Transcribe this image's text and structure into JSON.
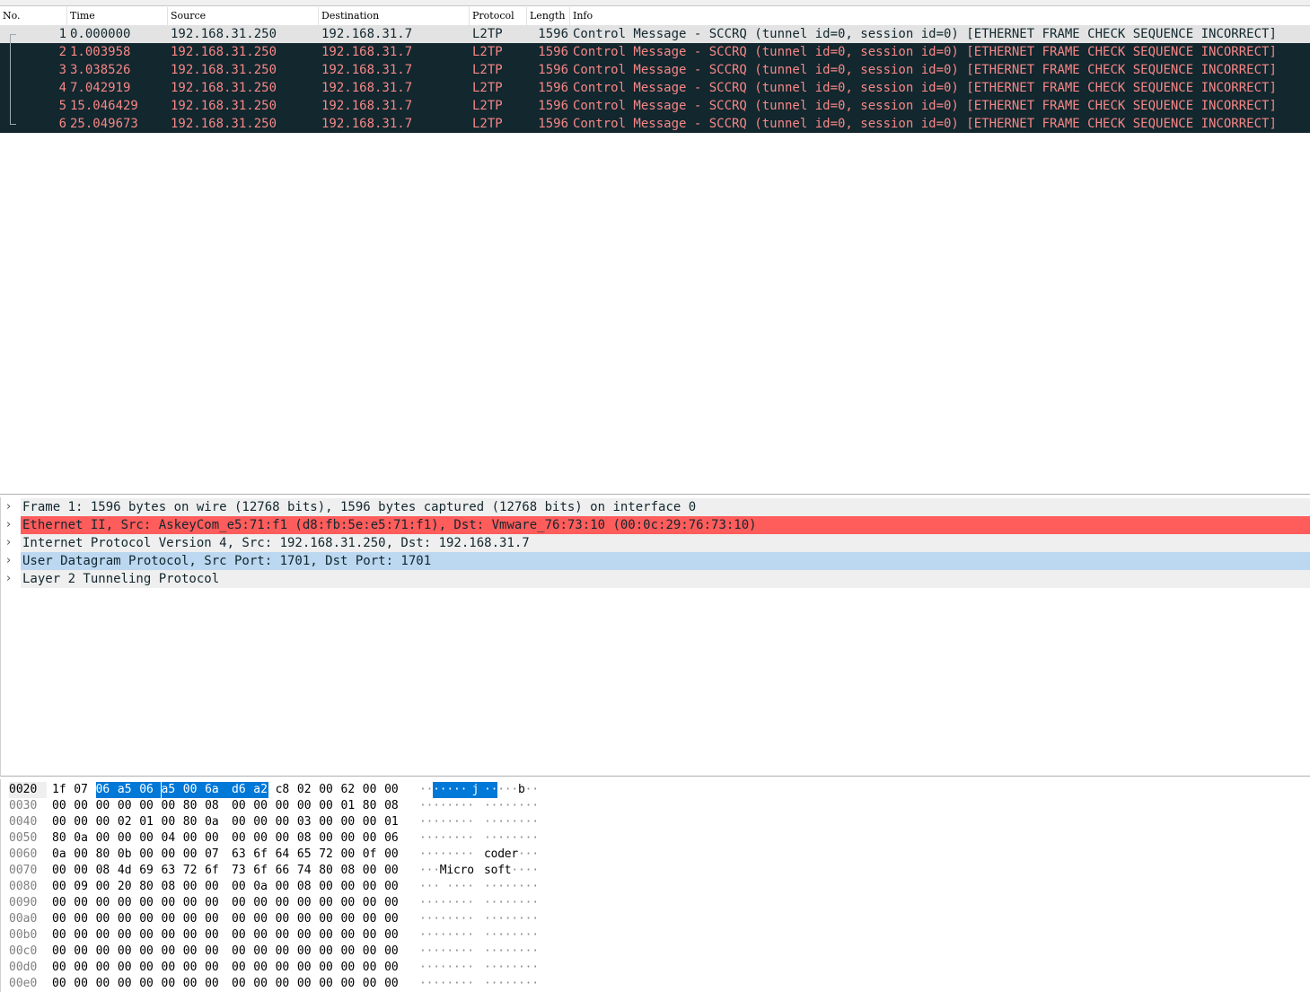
{
  "columns": [
    "No.",
    "Time",
    "Source",
    "Destination",
    "Protocol",
    "Length",
    "Info"
  ],
  "packets": [
    {
      "no": "1",
      "time": "0.000000",
      "source": "192.168.31.250",
      "destination": "192.168.31.7",
      "protocol": "L2TP",
      "length": "1596",
      "info": "Control Message - SCCRQ (tunnel id=0, session id=0) [ETHERNET FRAME CHECK SEQUENCE INCORRECT]"
    },
    {
      "no": "2",
      "time": "1.003958",
      "source": "192.168.31.250",
      "destination": "192.168.31.7",
      "protocol": "L2TP",
      "length": "1596",
      "info": "Control Message - SCCRQ (tunnel id=0, session id=0) [ETHERNET FRAME CHECK SEQUENCE INCORRECT]"
    },
    {
      "no": "3",
      "time": "3.038526",
      "source": "192.168.31.250",
      "destination": "192.168.31.7",
      "protocol": "L2TP",
      "length": "1596",
      "info": "Control Message - SCCRQ (tunnel id=0, session id=0) [ETHERNET FRAME CHECK SEQUENCE INCORRECT]"
    },
    {
      "no": "4",
      "time": "7.042919",
      "source": "192.168.31.250",
      "destination": "192.168.31.7",
      "protocol": "L2TP",
      "length": "1596",
      "info": "Control Message - SCCRQ (tunnel id=0, session id=0) [ETHERNET FRAME CHECK SEQUENCE INCORRECT]"
    },
    {
      "no": "5",
      "time": "15.046429",
      "source": "192.168.31.250",
      "destination": "192.168.31.7",
      "protocol": "L2TP",
      "length": "1596",
      "info": "Control Message - SCCRQ (tunnel id=0, session id=0) [ETHERNET FRAME CHECK SEQUENCE INCORRECT]"
    },
    {
      "no": "6",
      "time": "25.049673",
      "source": "192.168.31.250",
      "destination": "192.168.31.7",
      "protocol": "L2TP",
      "length": "1596",
      "info": "Control Message - SCCRQ (tunnel id=0, session id=0) [ETHERNET FRAME CHECK SEQUENCE INCORRECT]"
    }
  ],
  "details": [
    {
      "text": "Frame 1: 1596 bytes on wire (12768 bits), 1596 bytes captured (12768 bits) on interface 0",
      "style": "gray"
    },
    {
      "text": "Ethernet II, Src: AskeyCom_e5:71:f1 (d8:fb:5e:e5:71:f1), Dst: Vmware_76:73:10 (00:0c:29:76:73:10)",
      "style": "red"
    },
    {
      "text": "Internet Protocol Version 4, Src: 192.168.31.250, Dst: 192.168.31.7",
      "style": "gray"
    },
    {
      "text": "User Datagram Protocol, Src Port: 1701, Dst Port: 1701",
      "style": "blue"
    },
    {
      "text": "Layer 2 Tunneling Protocol",
      "style": "gray"
    }
  ],
  "bytes": [
    {
      "offset": "0020",
      "hex": [
        "1f",
        "07",
        "06",
        "a5",
        "06",
        "a5",
        "00",
        "6a",
        "d6",
        "a2",
        "c8",
        "02",
        "00",
        "62",
        "00",
        "00"
      ],
      "ascii": [
        "·",
        "·",
        "·",
        "·",
        "·",
        "·",
        "·",
        "j",
        "·",
        "·",
        "·",
        "·",
        "·",
        "b",
        "·",
        "·"
      ],
      "highlight": [
        2,
        3,
        4,
        5,
        6,
        7,
        8,
        9
      ]
    },
    {
      "offset": "0030",
      "hex": [
        "00",
        "00",
        "00",
        "00",
        "00",
        "00",
        "80",
        "08",
        "00",
        "00",
        "00",
        "00",
        "00",
        "01",
        "80",
        "08"
      ],
      "ascii": [
        "·",
        "·",
        "·",
        "·",
        "·",
        "·",
        "·",
        "·",
        "·",
        "·",
        "·",
        "·",
        "·",
        "·",
        "·",
        "·"
      ],
      "highlight": []
    },
    {
      "offset": "0040",
      "hex": [
        "00",
        "00",
        "00",
        "02",
        "01",
        "00",
        "80",
        "0a",
        "00",
        "00",
        "00",
        "03",
        "00",
        "00",
        "00",
        "01"
      ],
      "ascii": [
        "·",
        "·",
        "·",
        "·",
        "·",
        "·",
        "·",
        "·",
        "·",
        "·",
        "·",
        "·",
        "·",
        "·",
        "·",
        "·"
      ],
      "highlight": []
    },
    {
      "offset": "0050",
      "hex": [
        "80",
        "0a",
        "00",
        "00",
        "00",
        "04",
        "00",
        "00",
        "00",
        "00",
        "00",
        "08",
        "00",
        "00",
        "00",
        "06"
      ],
      "ascii": [
        "·",
        "·",
        "·",
        "·",
        "·",
        "·",
        "·",
        "·",
        "·",
        "·",
        "·",
        "·",
        "·",
        "·",
        "·",
        "·"
      ],
      "highlight": []
    },
    {
      "offset": "0060",
      "hex": [
        "0a",
        "00",
        "80",
        "0b",
        "00",
        "00",
        "00",
        "07",
        "63",
        "6f",
        "64",
        "65",
        "72",
        "00",
        "0f",
        "00"
      ],
      "ascii": [
        "·",
        "·",
        "·",
        "·",
        "·",
        "·",
        "·",
        "·",
        "c",
        "o",
        "d",
        "e",
        "r",
        "·",
        "·",
        "·"
      ],
      "highlight": []
    },
    {
      "offset": "0070",
      "hex": [
        "00",
        "00",
        "08",
        "4d",
        "69",
        "63",
        "72",
        "6f",
        "73",
        "6f",
        "66",
        "74",
        "80",
        "08",
        "00",
        "00"
      ],
      "ascii": [
        "·",
        "·",
        "·",
        "M",
        "i",
        "c",
        "r",
        "o",
        "s",
        "o",
        "f",
        "t",
        "·",
        "·",
        "·",
        "·"
      ],
      "highlight": []
    },
    {
      "offset": "0080",
      "hex": [
        "00",
        "09",
        "00",
        "20",
        "80",
        "08",
        "00",
        "00",
        "00",
        "0a",
        "00",
        "08",
        "00",
        "00",
        "00",
        "00"
      ],
      "ascii": [
        "·",
        "·",
        "·",
        " ",
        "·",
        "·",
        "·",
        "·",
        "·",
        "·",
        "·",
        "·",
        "·",
        "·",
        "·",
        "·"
      ],
      "highlight": []
    },
    {
      "offset": "0090",
      "hex": [
        "00",
        "00",
        "00",
        "00",
        "00",
        "00",
        "00",
        "00",
        "00",
        "00",
        "00",
        "00",
        "00",
        "00",
        "00",
        "00"
      ],
      "ascii": [
        "·",
        "·",
        "·",
        "·",
        "·",
        "·",
        "·",
        "·",
        "·",
        "·",
        "·",
        "·",
        "·",
        "·",
        "·",
        "·"
      ],
      "highlight": []
    },
    {
      "offset": "00a0",
      "hex": [
        "00",
        "00",
        "00",
        "00",
        "00",
        "00",
        "00",
        "00",
        "00",
        "00",
        "00",
        "00",
        "00",
        "00",
        "00",
        "00"
      ],
      "ascii": [
        "·",
        "·",
        "·",
        "·",
        "·",
        "·",
        "·",
        "·",
        "·",
        "·",
        "·",
        "·",
        "·",
        "·",
        "·",
        "·"
      ],
      "highlight": []
    },
    {
      "offset": "00b0",
      "hex": [
        "00",
        "00",
        "00",
        "00",
        "00",
        "00",
        "00",
        "00",
        "00",
        "00",
        "00",
        "00",
        "00",
        "00",
        "00",
        "00"
      ],
      "ascii": [
        "·",
        "·",
        "·",
        "·",
        "·",
        "·",
        "·",
        "·",
        "·",
        "·",
        "·",
        "·",
        "·",
        "·",
        "·",
        "·"
      ],
      "highlight": []
    },
    {
      "offset": "00c0",
      "hex": [
        "00",
        "00",
        "00",
        "00",
        "00",
        "00",
        "00",
        "00",
        "00",
        "00",
        "00",
        "00",
        "00",
        "00",
        "00",
        "00"
      ],
      "ascii": [
        "·",
        "·",
        "·",
        "·",
        "·",
        "·",
        "·",
        "·",
        "·",
        "·",
        "·",
        "·",
        "·",
        "·",
        "·",
        "·"
      ],
      "highlight": []
    },
    {
      "offset": "00d0",
      "hex": [
        "00",
        "00",
        "00",
        "00",
        "00",
        "00",
        "00",
        "00",
        "00",
        "00",
        "00",
        "00",
        "00",
        "00",
        "00",
        "00"
      ],
      "ascii": [
        "·",
        "·",
        "·",
        "·",
        "·",
        "·",
        "·",
        "·",
        "·",
        "·",
        "·",
        "·",
        "·",
        "·",
        "·",
        "·"
      ],
      "highlight": []
    },
    {
      "offset": "00e0",
      "hex": [
        "00",
        "00",
        "00",
        "00",
        "00",
        "00",
        "00",
        "00",
        "00",
        "00",
        "00",
        "00",
        "00",
        "00",
        "00",
        "00"
      ],
      "ascii": [
        "·",
        "·",
        "·",
        "·",
        "·",
        "·",
        "·",
        "·",
        "·",
        "·",
        "·",
        "·",
        "·",
        "·",
        "·",
        "·"
      ],
      "highlight": []
    }
  ],
  "colors": {
    "selected_row_bg": "#12272e",
    "selected_row_fg": "#f78787",
    "first_row_bg": "#e3e3e3",
    "eth_bg": "#ff5c5c",
    "udp_bg": "#bcd7f0",
    "byte_hl": "#0078d7"
  }
}
